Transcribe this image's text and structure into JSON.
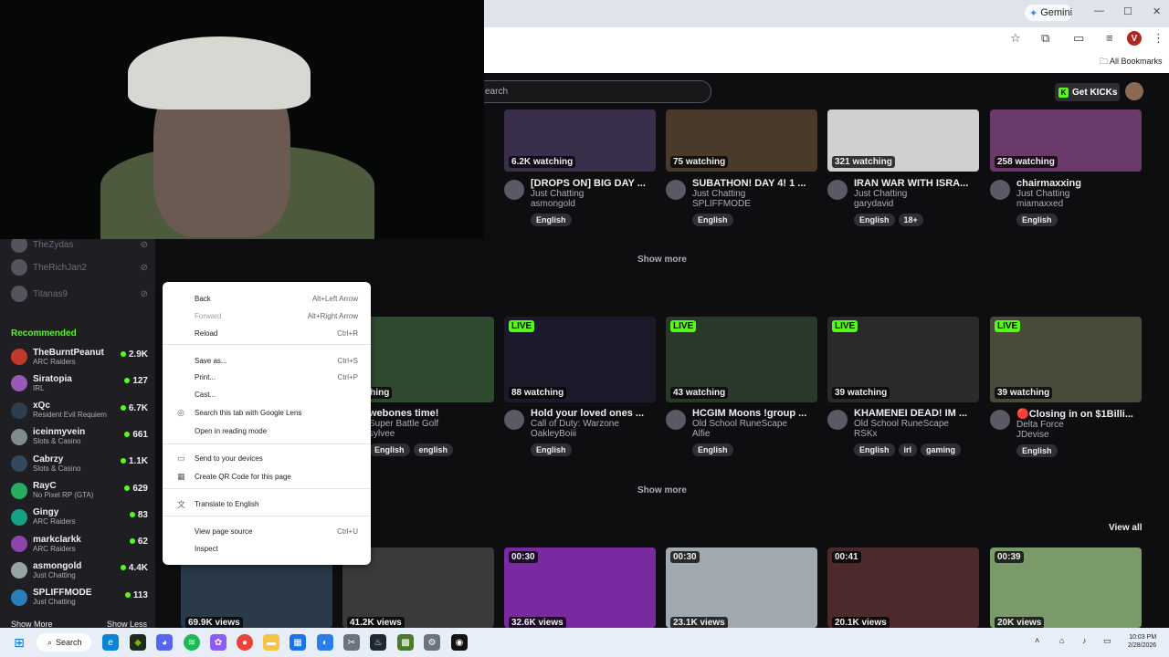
{
  "browser": {
    "gemini_label": "Gemini",
    "all_bookmarks": "All Bookmarks",
    "profile_initial": "V"
  },
  "kick": {
    "search_placeholder": "earch",
    "get_kicks": "Get KICKs"
  },
  "sidebar": {
    "followed_offline": [
      "TheZydas",
      "TheRichJan2",
      "Titanas9"
    ],
    "recommended_heading": "Recommended",
    "recommended": [
      {
        "name": "TheBurntPeanut",
        "category": "ARC Raiders",
        "count": "2.9K"
      },
      {
        "name": "Siratopia",
        "category": "IRL",
        "count": "127"
      },
      {
        "name": "xQc",
        "category": "Resident Evil Requiem",
        "count": "6.7K"
      },
      {
        "name": "iceinmyvein",
        "category": "Slots & Casino",
        "count": "661"
      },
      {
        "name": "Cabrzy",
        "category": "Slots & Casino",
        "count": "1.1K"
      },
      {
        "name": "RayC",
        "category": "No Pixel RP (GTA)",
        "count": "629"
      },
      {
        "name": "Gingy",
        "category": "ARC Raiders",
        "count": "83"
      },
      {
        "name": "markclarkk",
        "category": "ARC Raiders",
        "count": "62"
      },
      {
        "name": "asmongold",
        "category": "Just Chatting",
        "count": "4.4K"
      },
      {
        "name": "SPLIFFMODE",
        "category": "Just Chatting",
        "count": "113"
      }
    ],
    "show_more": "Show More",
    "show_less": "Show Less"
  },
  "row1": [
    {
      "watching": "6.2K watching",
      "title": "[DROPS ON] BIG DAY ...",
      "category": "Just Chatting",
      "user": "asmongold",
      "tags": [
        "English"
      ]
    },
    {
      "watching": "75 watching",
      "title": "SUBATHON! DAY 4! 1 ...",
      "category": "Just Chatting",
      "user": "SPLIFFMODE",
      "tags": [
        "English"
      ]
    },
    {
      "watching": "321 watching",
      "title": "IRAN WAR WITH ISRA...",
      "category": "Just Chatting",
      "user": "garydavid",
      "tags": [
        "English",
        "18+"
      ]
    },
    {
      "watching": "258 watching",
      "title": "chairmaxxing",
      "category": "Just Chatting",
      "user": "miamaxxed",
      "tags": [
        "English"
      ]
    }
  ],
  "show_more": "Show more",
  "row2": [
    {
      "live": "",
      "watching": "watching",
      "title": "webones time!",
      "category": "Super Battle Golf",
      "user": "sylvee",
      "tags": [
        "English",
        "english"
      ]
    },
    {
      "live": "LIVE",
      "watching": "88 watching",
      "title": "Hold your loved ones ...",
      "category": "Call of Duty: Warzone",
      "user": "OakleyBoiii",
      "tags": [
        "English"
      ]
    },
    {
      "live": "LIVE",
      "watching": "43 watching",
      "title": "HCGIM Moons !group ...",
      "category": "Old School RuneScape",
      "user": "Alfie",
      "tags": [
        "English"
      ]
    },
    {
      "live": "LIVE",
      "watching": "39 watching",
      "title": "KHAMENEI DEAD! IM ...",
      "category": "Old School RuneScape",
      "user": "RSKx",
      "tags": [
        "English",
        "irl",
        "gaming"
      ]
    },
    {
      "live": "LIVE",
      "watching": "39 watching",
      "title": "🔴Closing in on $1Billi...",
      "category": "Delta Force",
      "user": "JDevise",
      "tags": [
        "English"
      ]
    }
  ],
  "view_all": "View all",
  "clips": [
    {
      "duration": "",
      "views": "69.9K views"
    },
    {
      "duration": "",
      "views": "41.2K views"
    },
    {
      "duration": "00:30",
      "views": "32.6K views"
    },
    {
      "duration": "00:30",
      "views": "23.1K views"
    },
    {
      "duration": "00:41",
      "views": "20.1K views"
    },
    {
      "duration": "00:39",
      "views": "20K views"
    }
  ],
  "context_menu": {
    "back": "Back",
    "back_sc": "Alt+Left Arrow",
    "forward": "Forward",
    "forward_sc": "Alt+Right Arrow",
    "reload": "Reload",
    "reload_sc": "Ctrl+R",
    "save_as": "Save as...",
    "save_as_sc": "Ctrl+S",
    "print": "Print...",
    "print_sc": "Ctrl+P",
    "cast": "Cast...",
    "lens": "Search this tab with Google Lens",
    "reading": "Open in reading mode",
    "send": "Send to your devices",
    "qr": "Create QR Code for this page",
    "translate": "Translate to English",
    "view_source": "View page source",
    "view_source_sc": "Ctrl+U",
    "inspect": "Inspect"
  },
  "taskbar": {
    "search": "Search",
    "time": "10:03 PM",
    "date": "2/28/2026"
  },
  "colors": {
    "accent": "#53fc18",
    "bg": "#0e0e10",
    "sidebar": "#1f1f23"
  }
}
